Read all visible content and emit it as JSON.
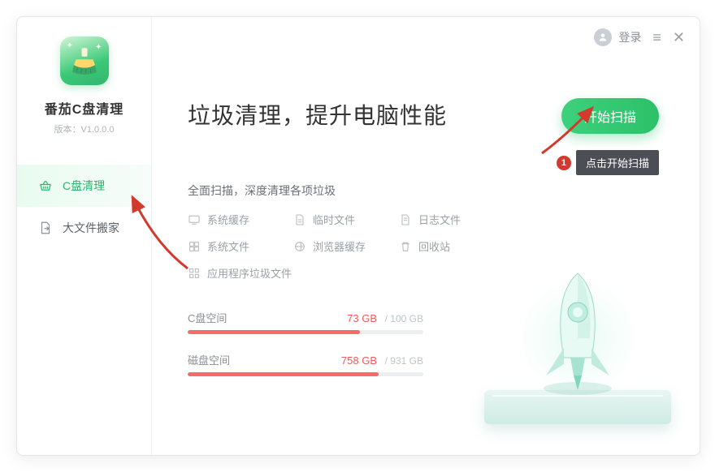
{
  "app": {
    "name": "番茄C盘清理",
    "version_label": "版本：V1.0.0.0"
  },
  "header": {
    "login_label": "登录"
  },
  "sidebar": {
    "items": [
      {
        "label": "C盘清理"
      },
      {
        "label": "大文件搬家"
      }
    ]
  },
  "main": {
    "headline": "垃圾清理，提升电脑性能",
    "scan_button_label": "开始扫描",
    "subtitle": "全面扫描，深度清理各项垃圾",
    "categories": [
      "系统缓存",
      "临时文件",
      "日志文件",
      "系统文件",
      "浏览器缓存",
      "回收站",
      "应用程序垃圾文件"
    ],
    "disks": [
      {
        "name": "C盘空间",
        "used_label": "73 GB",
        "total_label": "100 GB",
        "fill_percent": 73
      },
      {
        "name": "磁盘空间",
        "used_label": "758 GB",
        "total_label": "931 GB",
        "fill_percent": 81
      }
    ]
  },
  "annotation": {
    "badge": "1",
    "text": "点击开始扫描"
  }
}
